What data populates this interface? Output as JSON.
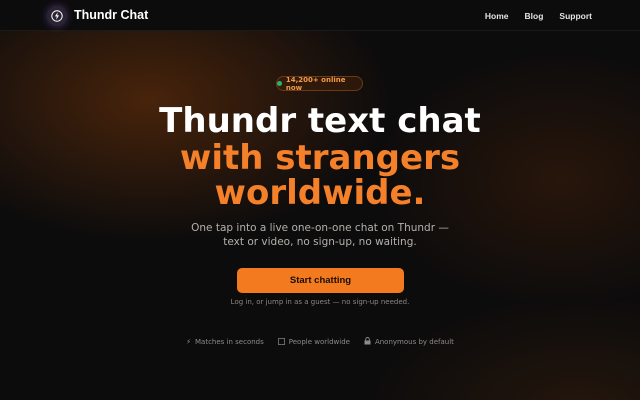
{
  "header": {
    "brand": "Thundr Chat",
    "logo_icon": "lightning-bolt-icon",
    "nav": [
      {
        "label": "Home"
      },
      {
        "label": "Blog"
      },
      {
        "label": "Support"
      }
    ]
  },
  "hero": {
    "online_badge": "14,200+ online now",
    "headline_line1": "Thundr text chat",
    "headline_line2": "with strangers",
    "headline_line3": "worldwide.",
    "subtitle_line1": "One tap into a live one-on-one chat on Thundr —",
    "subtitle_line2": "text or video, no sign-up, no waiting.",
    "cta_label": "Start chatting",
    "note": "Log in, or jump in as a guest — no sign-up needed."
  },
  "features": [
    {
      "icon": "lightning-icon",
      "label": "Matches in seconds"
    },
    {
      "icon": "globe-icon",
      "label": "People worldwide"
    },
    {
      "icon": "lock-icon",
      "label": "Anonymous by default"
    }
  ],
  "colors": {
    "accent": "#f5802a",
    "button": "#f47a1f",
    "online_dot": "#2fb36a",
    "background": "#0d0c0c"
  }
}
